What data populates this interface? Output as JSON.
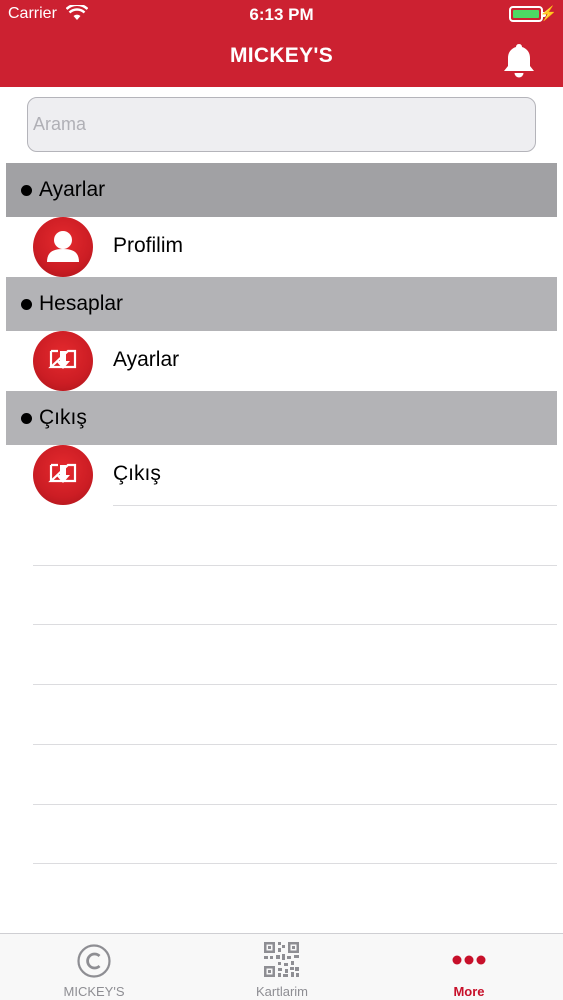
{
  "status_bar": {
    "carrier": "Carrier",
    "time": "6:13 PM"
  },
  "header": {
    "title": "MICKEY'S",
    "right_icon": "bell-icon"
  },
  "search": {
    "placeholder": "Arama",
    "value": ""
  },
  "sections": [
    {
      "title": "Ayarlar",
      "items": [
        {
          "label": "Profilim",
          "icon": "user-icon"
        }
      ]
    },
    {
      "title": "Hesaplar",
      "items": [
        {
          "label": "Ayarlar",
          "icon": "download-tray-icon"
        }
      ]
    },
    {
      "title": "Çıkış",
      "items": [
        {
          "label": "Çıkış",
          "icon": "download-tray-icon"
        }
      ]
    }
  ],
  "tabbar": {
    "tabs": [
      {
        "label": "MICKEY'S",
        "icon": "copyright-icon",
        "active": false
      },
      {
        "label": "Kartlarim",
        "icon": "qr-code-icon",
        "active": false
      },
      {
        "label": "More",
        "icon": "more-icon",
        "active": true
      }
    ]
  },
  "colors": {
    "brand": "#cc2131",
    "active_tab": "#c7102a",
    "battery": "#4cd964"
  }
}
